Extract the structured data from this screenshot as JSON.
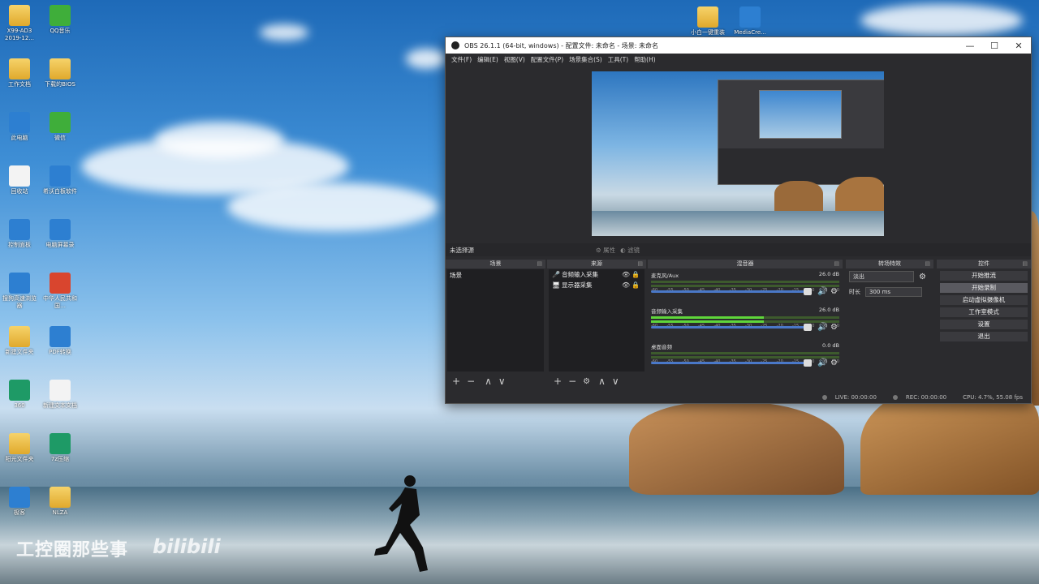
{
  "desktop": {
    "icons": [
      {
        "label": "X99-AD3 2019-12...",
        "kind": "folder"
      },
      {
        "label": "QQ音乐",
        "kind": "app-green"
      },
      {
        "label": "工作文档",
        "kind": "folder"
      },
      {
        "label": "下载的BIOS",
        "kind": "folder"
      },
      {
        "label": "此电脑",
        "kind": "app-blue"
      },
      {
        "label": "微信",
        "kind": "app-green"
      },
      {
        "label": "回收站",
        "kind": "app-white"
      },
      {
        "label": "希沃白板软件",
        "kind": "app-blue"
      },
      {
        "label": "控制面板",
        "kind": "app-blue"
      },
      {
        "label": "电脑屏幕录",
        "kind": "app-blue"
      },
      {
        "label": "搜狗高速浏览器",
        "kind": "app-blue"
      },
      {
        "label": "中华人民共和国…",
        "kind": "app-red"
      },
      {
        "label": "新建文件夹",
        "kind": "folder"
      },
      {
        "label": "PDF转换",
        "kind": "app-blue"
      },
      {
        "label": "360",
        "kind": "app-teal"
      },
      {
        "label": "新建文本文档",
        "kind": "app-white"
      },
      {
        "label": "阳光文件夹",
        "kind": "folder"
      },
      {
        "label": "7z压缩",
        "kind": "app-teal"
      },
      {
        "label": "极客",
        "kind": "app-blue"
      },
      {
        "label": "NLZA",
        "kind": "folder"
      }
    ],
    "top_icons": [
      {
        "label": "小白一键重装PE",
        "kind": "folder"
      },
      {
        "label": "MediaCre...",
        "kind": "app-blue"
      }
    ],
    "watermark": "工控圈那些事",
    "watermark_logo": "bilibili"
  },
  "obs": {
    "title": "OBS 26.1.1 (64-bit, windows) - 配置文件: 未命名 - 场景: 未命名",
    "window_buttons": {
      "minimize": "—",
      "maximize": "☐",
      "close": "✕"
    },
    "menu": [
      "文件(F)",
      "编辑(E)",
      "视图(V)",
      "配置文件(P)",
      "场景集合(S)",
      "工具(T)",
      "帮助(H)"
    ],
    "source_toolbar": {
      "no_source": "未选择源",
      "properties": "属性",
      "filters": "滤镜"
    },
    "docks": {
      "scenes": {
        "title": "场景",
        "items": [
          "场景"
        ]
      },
      "sources": {
        "title": "来源",
        "items": [
          {
            "icon": "🎤",
            "name": "音频输入采集"
          },
          {
            "icon": "🖥",
            "name": "显示器采集"
          }
        ]
      },
      "mixer": {
        "title": "混音器",
        "channels": [
          {
            "name": "麦克风/Aux",
            "db": "26.0 dB",
            "level": 0.0
          },
          {
            "name": "音频输入采集",
            "db": "26.0 dB",
            "level": 0.6
          },
          {
            "name": "桌面音频",
            "db": "0.0 dB",
            "level": 0.0
          }
        ],
        "scale": [
          "-60",
          "-55",
          "-50",
          "-45",
          "-40",
          "-35",
          "-30",
          "-25",
          "-20",
          "-15",
          "-10",
          "-5",
          "0"
        ]
      },
      "transitions": {
        "title": "转场特效",
        "type": "淡出",
        "duration_label": "时长",
        "duration_value": "300 ms"
      },
      "controls": {
        "title": "控件",
        "buttons": [
          "开始推流",
          "开始录制",
          "启动虚拟摄像机",
          "工作室模式",
          "设置",
          "退出"
        ]
      }
    },
    "status": {
      "live": "LIVE: 00:00:00",
      "rec": "REC: 00:00:00",
      "cpu": "CPU: 4.7%, 55.08 fps"
    }
  }
}
